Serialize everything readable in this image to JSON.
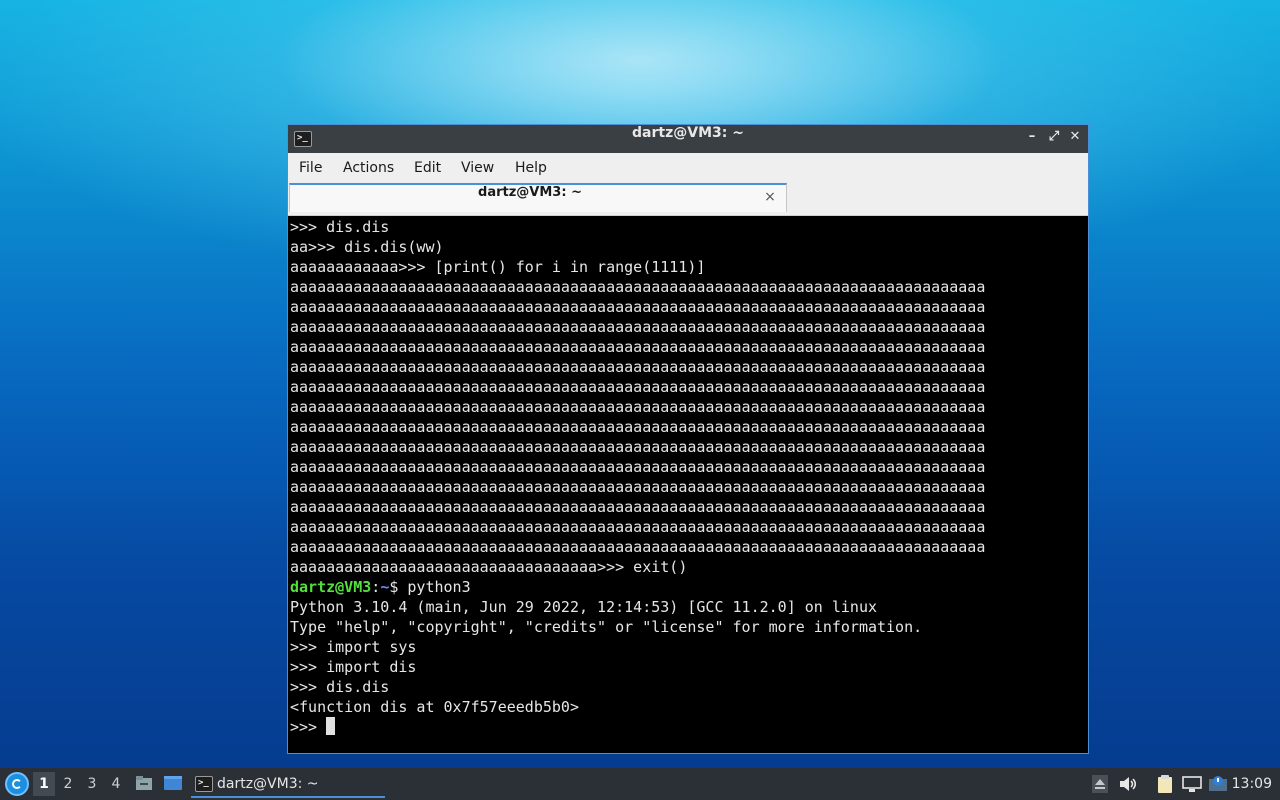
{
  "window": {
    "title": "dartz@VM3: ~",
    "app_icon": ">_",
    "controls": {
      "minimize": "–",
      "maximize": "⤢",
      "close": "✕"
    }
  },
  "menu": {
    "items": [
      "File",
      "Actions",
      "Edit",
      "View",
      "Help"
    ]
  },
  "tab": {
    "label": "dartz@VM3: ~",
    "close": "×"
  },
  "terminal": {
    "lines": [
      ">>> dis.dis",
      "aa>>> dis.dis(ww)",
      "aaaaaaaaaaaa>>> [print() for i in range(1111)]",
      "aaaaaaaaaaaaaaaaaaaaaaaaaaaaaaaaaaaaaaaaaaaaaaaaaaaaaaaaaaaaaaaaaaaaaaaaaaaaa",
      "aaaaaaaaaaaaaaaaaaaaaaaaaaaaaaaaaaaaaaaaaaaaaaaaaaaaaaaaaaaaaaaaaaaaaaaaaaaaa",
      "aaaaaaaaaaaaaaaaaaaaaaaaaaaaaaaaaaaaaaaaaaaaaaaaaaaaaaaaaaaaaaaaaaaaaaaaaaaaa",
      "aaaaaaaaaaaaaaaaaaaaaaaaaaaaaaaaaaaaaaaaaaaaaaaaaaaaaaaaaaaaaaaaaaaaaaaaaaaaa",
      "aaaaaaaaaaaaaaaaaaaaaaaaaaaaaaaaaaaaaaaaaaaaaaaaaaaaaaaaaaaaaaaaaaaaaaaaaaaaa",
      "aaaaaaaaaaaaaaaaaaaaaaaaaaaaaaaaaaaaaaaaaaaaaaaaaaaaaaaaaaaaaaaaaaaaaaaaaaaaa",
      "aaaaaaaaaaaaaaaaaaaaaaaaaaaaaaaaaaaaaaaaaaaaaaaaaaaaaaaaaaaaaaaaaaaaaaaaaaaaa",
      "aaaaaaaaaaaaaaaaaaaaaaaaaaaaaaaaaaaaaaaaaaaaaaaaaaaaaaaaaaaaaaaaaaaaaaaaaaaaa",
      "aaaaaaaaaaaaaaaaaaaaaaaaaaaaaaaaaaaaaaaaaaaaaaaaaaaaaaaaaaaaaaaaaaaaaaaaaaaaa",
      "aaaaaaaaaaaaaaaaaaaaaaaaaaaaaaaaaaaaaaaaaaaaaaaaaaaaaaaaaaaaaaaaaaaaaaaaaaaaa",
      "aaaaaaaaaaaaaaaaaaaaaaaaaaaaaaaaaaaaaaaaaaaaaaaaaaaaaaaaaaaaaaaaaaaaaaaaaaaaa",
      "aaaaaaaaaaaaaaaaaaaaaaaaaaaaaaaaaaaaaaaaaaaaaaaaaaaaaaaaaaaaaaaaaaaaaaaaaaaaa",
      "aaaaaaaaaaaaaaaaaaaaaaaaaaaaaaaaaaaaaaaaaaaaaaaaaaaaaaaaaaaaaaaaaaaaaaaaaaaaa",
      "aaaaaaaaaaaaaaaaaaaaaaaaaaaaaaaaaaaaaaaaaaaaaaaaaaaaaaaaaaaaaaaaaaaaaaaaaaaaa",
      "aaaaaaaaaaaaaaaaaaaaaaaaaaaaaaaaaa>>> exit()"
    ],
    "prompt": {
      "user_host": "dartz@VM3",
      "sep": ":",
      "path": "~",
      "dollar": "$ ",
      "command": "python3"
    },
    "after_lines": [
      "Python 3.10.4 (main, Jun 29 2022, 12:14:53) [GCC 11.2.0] on linux",
      "Type \"help\", \"copyright\", \"credits\" or \"license\" for more information.",
      ">>> import sys",
      ">>> import dis",
      ">>> dis.dis",
      "<function dis at 0x7f57eeedb5b0>"
    ],
    "current_prompt": ">>> "
  },
  "taskbar": {
    "workspaces": [
      "1",
      "2",
      "3",
      "4"
    ],
    "active_workspace": "1",
    "task_label": "dartz@VM3: ~",
    "clock": "13:09"
  },
  "colors": {
    "accent": "#4a90d9",
    "prompt_user": "#54e03a",
    "prompt_path": "#6b8cff"
  }
}
